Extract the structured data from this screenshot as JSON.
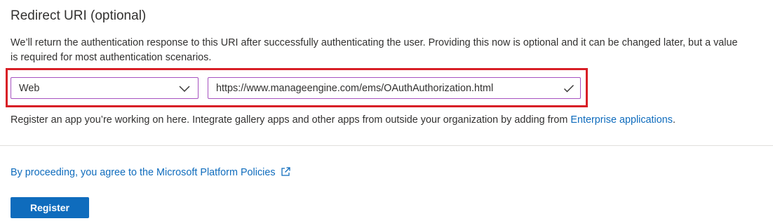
{
  "section": {
    "title": "Redirect URI (optional)",
    "description": "We’ll return the authentication response to this URI after successfully authenticating the user. Providing this now is optional and it can be changed later, but a value is required for most authentication scenarios."
  },
  "redirect": {
    "platform_value": "Web",
    "platform_icon": "chevron-down-icon",
    "uri_value": "https://www.manageengine.com/ems/OAuthAuthorization.html",
    "uri_status_icon": "checkmark-icon",
    "highlight_color": "#d81f26"
  },
  "helper": {
    "text": "Register an app you’re working on here. Integrate gallery apps and other apps from outside your organization by adding from ",
    "link_label": "Enterprise applications",
    "suffix": "."
  },
  "policy": {
    "link_label": "By proceeding, you agree to the Microsoft Platform Policies",
    "icon": "external-link-icon"
  },
  "actions": {
    "register_label": "Register"
  },
  "colors": {
    "accent": "#0f6cbd",
    "field_border": "#a652c0",
    "text": "#323130"
  }
}
